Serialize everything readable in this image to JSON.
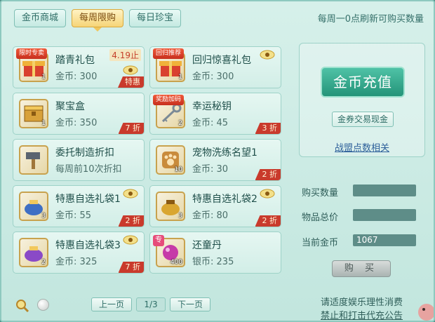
{
  "tabs": [
    {
      "label": "金币商城",
      "active": false
    },
    {
      "label": "每周限购",
      "active": true
    },
    {
      "label": "每日珍宝",
      "active": false
    }
  ],
  "refresh_note": "每周一0点刷新可购买数量",
  "items": [
    {
      "name": "踏青礼包",
      "price_label": "金币:",
      "price": "300",
      "badge": "限时专卖",
      "expiry": "4.19止",
      "discount": "特惠",
      "qty": "1",
      "icon": "gift-chest-icon"
    },
    {
      "name": "回归惊喜礼包",
      "price_label": "金币:",
      "price": "300",
      "badge": "回归推荐",
      "discount": "",
      "qty": "1",
      "icon": "gift-chest-icon"
    },
    {
      "name": "聚宝盒",
      "price_label": "金币:",
      "price": "350",
      "discount": "7 折",
      "qty": "1",
      "icon": "treasure-box-icon"
    },
    {
      "name": "幸运秘钥",
      "price_label": "金币:",
      "price": "45",
      "badge": "奖励加码",
      "discount": "3 折",
      "qty": "2",
      "icon": "key-icon"
    },
    {
      "name": "委托制造折扣",
      "desc": "每周前10次折扣",
      "icon": "hammer-icon"
    },
    {
      "name": "宠物洗练名望1",
      "price_label": "金币:",
      "price": "30",
      "discount": "2 折",
      "qty": "10",
      "icon": "paw-scroll-icon"
    },
    {
      "name": "特惠自选礼袋1",
      "price_label": "金币:",
      "price": "55",
      "discount": "2 折",
      "qty": "3",
      "icon": "blue-bag-icon"
    },
    {
      "name": "特惠自选礼袋2",
      "price_label": "金币:",
      "price": "80",
      "discount": "2 折",
      "qty": "3",
      "icon": "gold-bag-icon"
    },
    {
      "name": "特惠自选礼袋3",
      "price_label": "金币:",
      "price": "325",
      "discount": "7 折",
      "qty": "2",
      "icon": "purple-bag-icon"
    },
    {
      "name": "还童丹",
      "price_label": "银币:",
      "price": "235",
      "badge": "专",
      "qty": "400",
      "icon": "pill-icon"
    }
  ],
  "right": {
    "recharge": "金币充值",
    "coupon": "金券交易现金",
    "alliance": "战盟点数相关"
  },
  "form": {
    "qty_label": "购买数量",
    "qty_value": "",
    "total_label": "物品总价",
    "total_value": "",
    "coins_label": "当前金币",
    "coins_value": "1067"
  },
  "buy_label": "购 买",
  "pager": {
    "prev": "上一页",
    "page": "1/3",
    "next": "下一页"
  },
  "notes": {
    "line1": "请适度娱乐理性消费",
    "line2": "禁止和打击代充公告"
  },
  "colors": {
    "accent": "#249479",
    "discount": "#c93a2c",
    "active_tab": "#f6d477"
  }
}
